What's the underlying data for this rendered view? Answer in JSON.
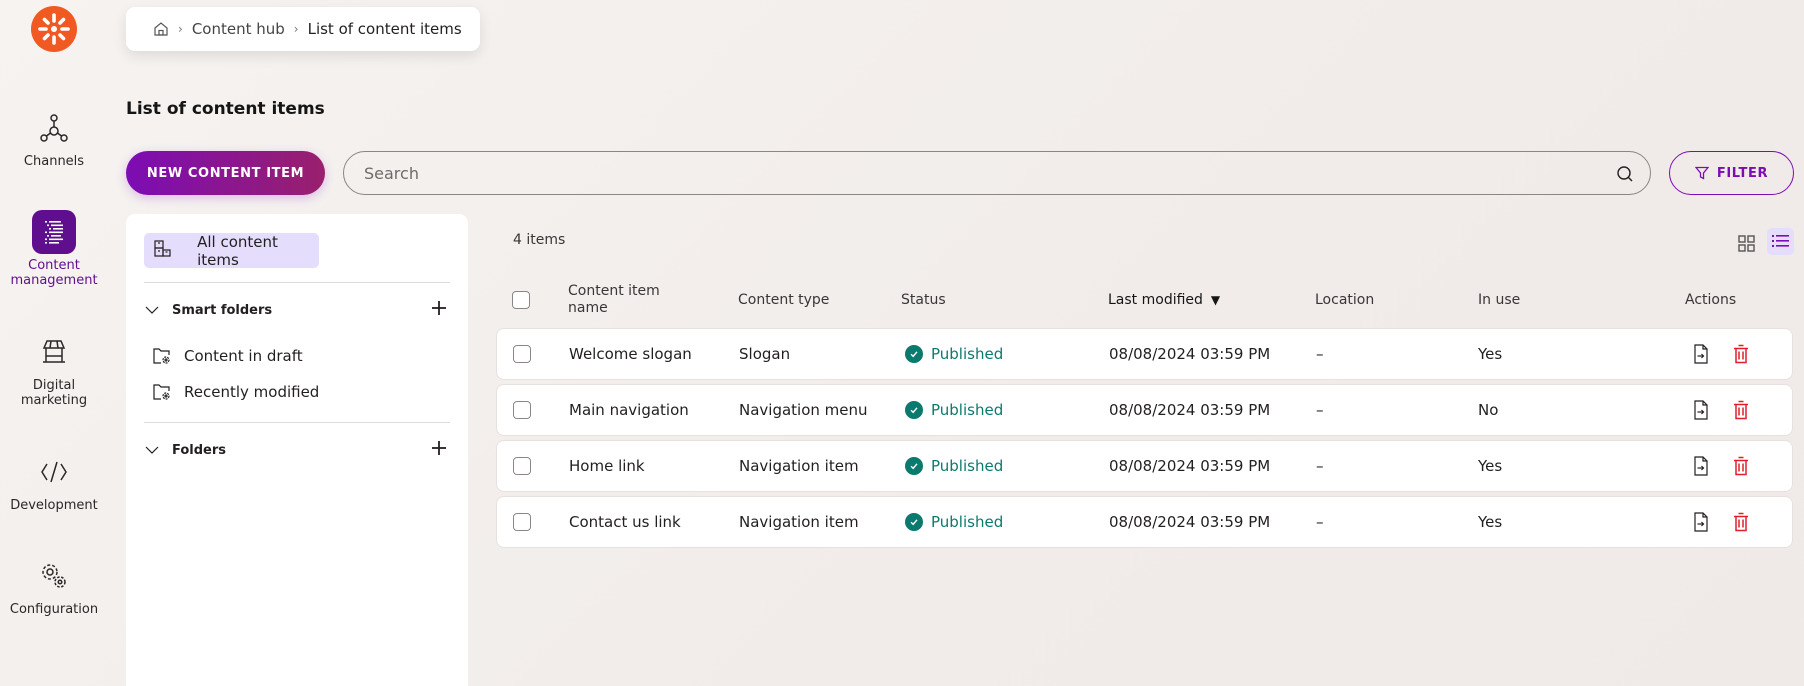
{
  "nav": {
    "logo": "kentico-logo-icon",
    "items": [
      {
        "label": "Channels",
        "icon": "channels-icon",
        "active": false
      },
      {
        "label": "Content management",
        "icon": "content-management-icon",
        "active": true
      },
      {
        "label": "Digital marketing",
        "icon": "storefront-icon",
        "active": false
      },
      {
        "label": "Development",
        "icon": "code-icon",
        "active": false
      },
      {
        "label": "Configuration",
        "icon": "gears-icon",
        "active": false
      }
    ],
    "labels": {
      "channels_1": "Channels",
      "content_1": "Content",
      "content_2": "management",
      "digital_1": "Digital",
      "digital_2": "marketing",
      "development_1": "Development",
      "configuration_1": "Configuration"
    }
  },
  "breadcrumb": {
    "home_icon": "home-icon",
    "items": [
      "Content hub",
      "List of content items"
    ],
    "separator": "›"
  },
  "page": {
    "title": "List of content items"
  },
  "toolbar": {
    "new_label": "NEW CONTENT ITEM",
    "search_placeholder": "Search",
    "search_value": "",
    "filter_label": "FILTER"
  },
  "folders": {
    "all_items_label": "All content items",
    "smart_folders_label": "Smart folders",
    "smart_folders": [
      "Content in draft",
      "Recently modified"
    ],
    "folders_label": "Folders"
  },
  "list": {
    "count_label": "4 items",
    "view_modes": [
      "grid",
      "list"
    ],
    "active_view": "list",
    "columns": {
      "name": "Content item name",
      "name_line1": "Content item",
      "name_line2": "name",
      "type": "Content type",
      "status": "Status",
      "modified": "Last modified",
      "modified_sort": "▼",
      "location": "Location",
      "in_use": "In use",
      "actions": "Actions"
    },
    "rows": [
      {
        "name": "Welcome slogan",
        "type": "Slogan",
        "status": "Published",
        "modified": "08/08/2024 03:59 PM",
        "location": "–",
        "in_use": "Yes"
      },
      {
        "name": "Main navigation",
        "type": "Navigation menu",
        "status": "Published",
        "modified": "08/08/2024 03:59 PM",
        "location": "–",
        "in_use": "No"
      },
      {
        "name": "Home link",
        "type": "Navigation item",
        "status": "Published",
        "modified": "08/08/2024 03:59 PM",
        "location": "–",
        "in_use": "Yes"
      },
      {
        "name": "Contact us link",
        "type": "Navigation item",
        "status": "Published",
        "modified": "08/08/2024 03:59 PM",
        "location": "–",
        "in_use": "Yes"
      }
    ]
  },
  "colors": {
    "brand_orange": "#f05a22",
    "accent_purple": "#7c0cb4",
    "active_nav": "#5f0f8e",
    "selected_bg": "#e4ddfc",
    "published_green": "#0b7a6e",
    "delete_red": "#e01e2b"
  }
}
